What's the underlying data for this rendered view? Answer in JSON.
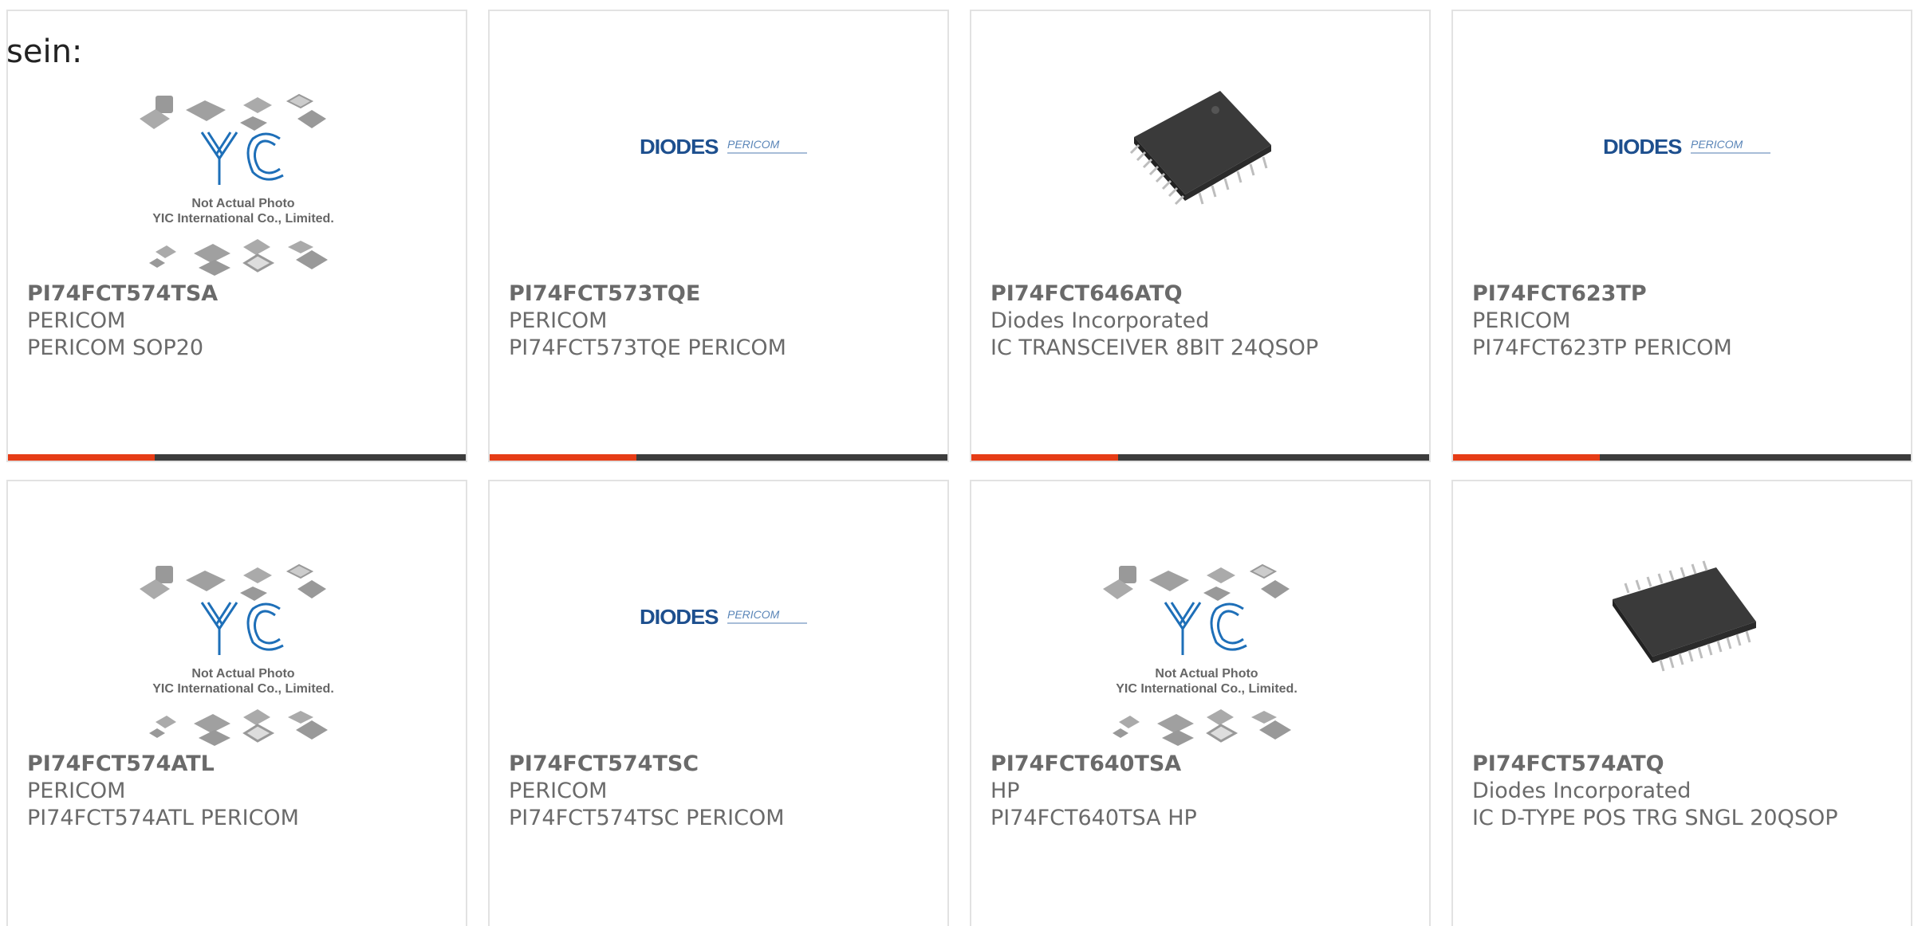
{
  "fragment_text": "sein:",
  "placeholder": {
    "caption_line1": "Not Actual Photo",
    "caption_line2": "YIC International Co., Limited.",
    "logo_text": "YIC"
  },
  "diodes_logo": {
    "brand": "DIODES",
    "secondary": "PERICOM"
  },
  "colors": {
    "accent": "#e63c16",
    "bar_dark": "#3c3c3c",
    "text": "#6a6a6a",
    "yic_blue": "#1e6fb8",
    "diodes_blue": "#1d4f8e"
  },
  "products": [
    {
      "part": "PI74FCT574TSA",
      "maker": "PERICOM",
      "desc": "PERICOM SOP20",
      "image": "yic-placeholder"
    },
    {
      "part": "PI74FCT573TQE",
      "maker": "PERICOM",
      "desc": "PI74FCT573TQE PERICOM",
      "image": "diodes-logo"
    },
    {
      "part": "PI74FCT646ATQ",
      "maker": "Diodes Incorporated",
      "desc": "IC TRANSCEIVER 8BIT 24QSOP",
      "image": "chip-photo"
    },
    {
      "part": "PI74FCT623TP",
      "maker": "PERICOM",
      "desc": "PI74FCT623TP PERICOM",
      "image": "diodes-logo"
    },
    {
      "part": "PI74FCT574ATL",
      "maker": "PERICOM",
      "desc": "PI74FCT574ATL PERICOM",
      "image": "yic-placeholder"
    },
    {
      "part": "PI74FCT574TSC",
      "maker": "PERICOM",
      "desc": "PI74FCT574TSC PERICOM",
      "image": "diodes-logo"
    },
    {
      "part": "PI74FCT640TSA",
      "maker": "HP",
      "desc": "PI74FCT640TSA HP",
      "image": "yic-placeholder"
    },
    {
      "part": "PI74FCT574ATQ",
      "maker": "Diodes Incorporated",
      "desc": "IC D-TYPE POS TRG SNGL 20QSOP",
      "image": "chip-photo"
    }
  ]
}
